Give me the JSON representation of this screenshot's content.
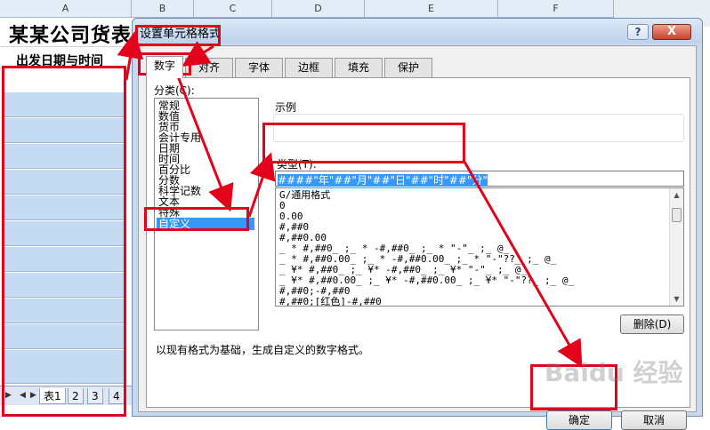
{
  "sheet": {
    "columns": [
      "A",
      "B",
      "C",
      "D",
      "E",
      "F"
    ],
    "title": "某某公司货表",
    "subtitle": "出发日期与时间",
    "tabs": [
      "表1",
      "2",
      "3",
      "4"
    ]
  },
  "dialog": {
    "title": "设置单元格格式",
    "help_glyph": "?",
    "close_glyph": "X",
    "tabs": [
      "数字",
      "对齐",
      "字体",
      "边框",
      "填充",
      "保护"
    ],
    "category_label": "分类(C):",
    "categories": [
      "常规",
      "数值",
      "货币",
      "会计专用",
      "日期",
      "时间",
      "百分比",
      "分数",
      "科学记数",
      "文本",
      "特殊",
      "自定义"
    ],
    "selected_category": "自定义",
    "sample_label": "示例",
    "type_label": "类型(T):",
    "type_value": "####\"年\"##\"月\"##\"日\"##\"时\"##\"分\"",
    "formats": [
      "G/通用格式",
      "0",
      "0.00",
      "#,##0",
      "#,##0.00",
      "_ * #,##0_ ;_ * -#,##0_ ;_ * \"-\"_ ;_ @_",
      "_ * #,##0.00_ ;_ * -#,##0.00_ ;_ * \"-\"??_ ;_ @_",
      "_ ¥* #,##0_ ;_ ¥* -#,##0_ ;_ ¥* \"-\"_ ;_ @_",
      "_ ¥* #,##0.00_ ;_ ¥* -#,##0.00_ ;_ ¥* \"-\"??_ ;_ @_",
      "#,##0;-#,##0",
      "#,##0;[红色]-#,##0"
    ],
    "delete_label": "删除(D)",
    "description": "以现有格式为基础，生成自定义的数字格式。",
    "ok_label": "确定",
    "cancel_label": "取消"
  },
  "watermark": "Baidu 经验",
  "colors": {
    "annotation": "#e3001b",
    "selection": "#3399ff",
    "cell_highlight": "#c5dbf3"
  }
}
